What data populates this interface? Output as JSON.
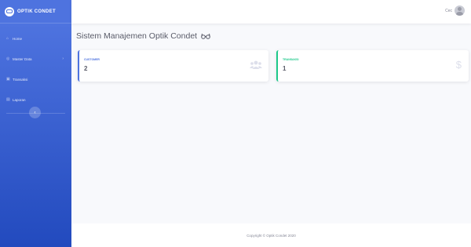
{
  "brand": {
    "name": "OPTIK CONDET"
  },
  "sidebar": {
    "items": [
      {
        "label": "Home",
        "icon": "home-icon"
      },
      {
        "label": "Master Data",
        "icon": "database-icon",
        "expandable": true
      },
      {
        "label": "Transaksi",
        "icon": "cart-icon"
      },
      {
        "label": "Laporan",
        "icon": "report-icon"
      }
    ],
    "toggle_icon": "chevron-left-icon"
  },
  "topbar": {
    "user_name": "Cec"
  },
  "page": {
    "title": "Sistem Manajemen Optik Condet"
  },
  "cards": [
    {
      "label": "CUSTOMER",
      "value": "2",
      "icon": "users-icon",
      "accent": "#4e73df"
    },
    {
      "label": "TRANSAKSI",
      "value": "1",
      "icon": "dollar-icon",
      "accent": "#1cc88a"
    }
  ],
  "footer": {
    "text": "Copyright © Optik Condet 2020"
  },
  "colors": {
    "sidebar_top": "#4e73df",
    "sidebar_bottom": "#224abe",
    "background": "#f8f9fc"
  }
}
